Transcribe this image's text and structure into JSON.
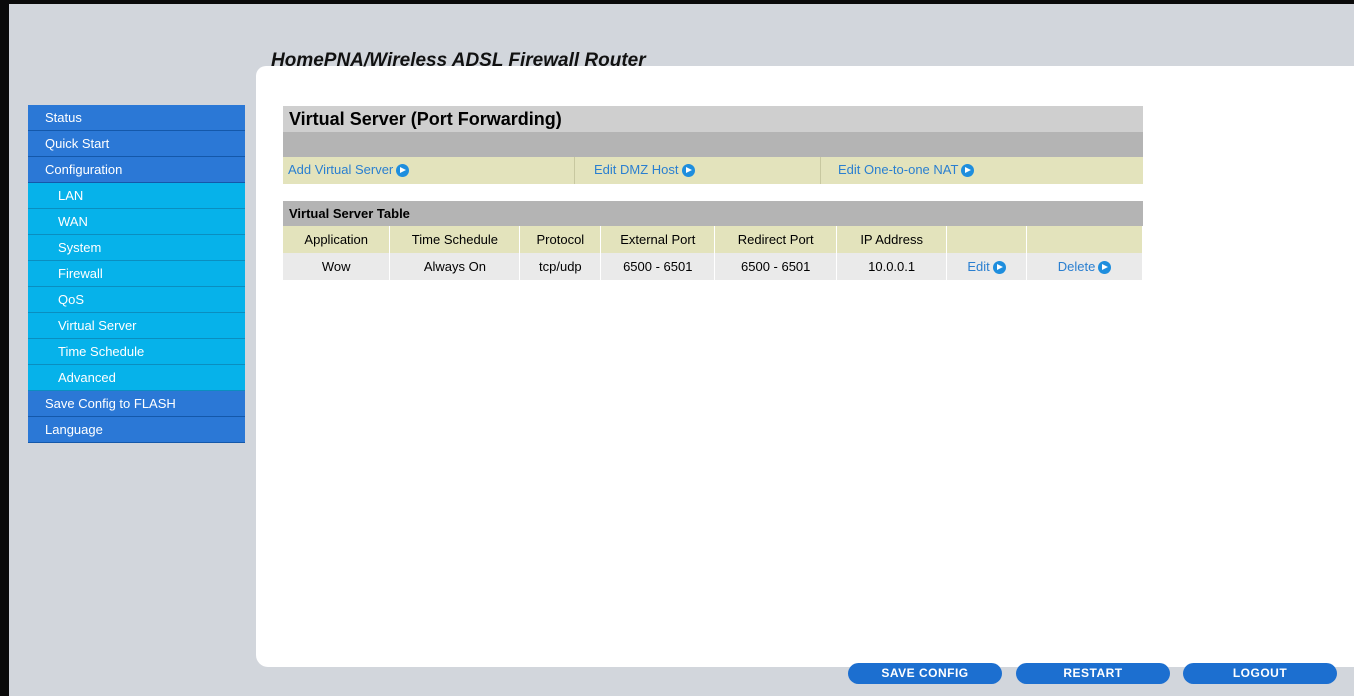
{
  "header": {
    "title": "HomePNA/Wireless ADSL Firewall Router"
  },
  "sidebar": {
    "items": [
      {
        "label": "Status",
        "level": "top"
      },
      {
        "label": "Quick Start",
        "level": "top"
      },
      {
        "label": "Configuration",
        "level": "top"
      },
      {
        "label": "LAN",
        "level": "sub"
      },
      {
        "label": "WAN",
        "level": "sub"
      },
      {
        "label": "System",
        "level": "sub"
      },
      {
        "label": "Firewall",
        "level": "sub"
      },
      {
        "label": "QoS",
        "level": "sub"
      },
      {
        "label": "Virtual Server",
        "level": "sub"
      },
      {
        "label": "Time Schedule",
        "level": "sub"
      },
      {
        "label": "Advanced",
        "level": "sub"
      },
      {
        "label": "Save Config to FLASH",
        "level": "top"
      },
      {
        "label": "Language",
        "level": "top"
      }
    ]
  },
  "main": {
    "heading": "Virtual Server (Port Forwarding)",
    "actions": {
      "add": "Add Virtual Server",
      "dmz": "Edit DMZ Host",
      "nat": "Edit One-to-one NAT"
    },
    "table": {
      "title": "Virtual Server Table",
      "columns": [
        "Application",
        "Time Schedule",
        "Protocol",
        "External Port",
        "Redirect Port",
        "IP Address",
        "",
        ""
      ],
      "rows": [
        {
          "application": "Wow",
          "time_schedule": "Always On",
          "protocol": "tcp/udp",
          "external_port": "6500 - 6501",
          "redirect_port": "6500 - 6501",
          "ip_address": "10.0.0.1",
          "edit": "Edit",
          "delete": "Delete"
        }
      ]
    }
  },
  "footer": {
    "save": "SAVE CONFIG",
    "restart": "RESTART",
    "logout": "LOGOUT"
  },
  "colors": {
    "nav_top": "#2b78d6",
    "nav_sub": "#06b2ea",
    "link": "#2a7fd0",
    "action_bar": "#e3e3bc",
    "button": "#1c6fd0"
  }
}
